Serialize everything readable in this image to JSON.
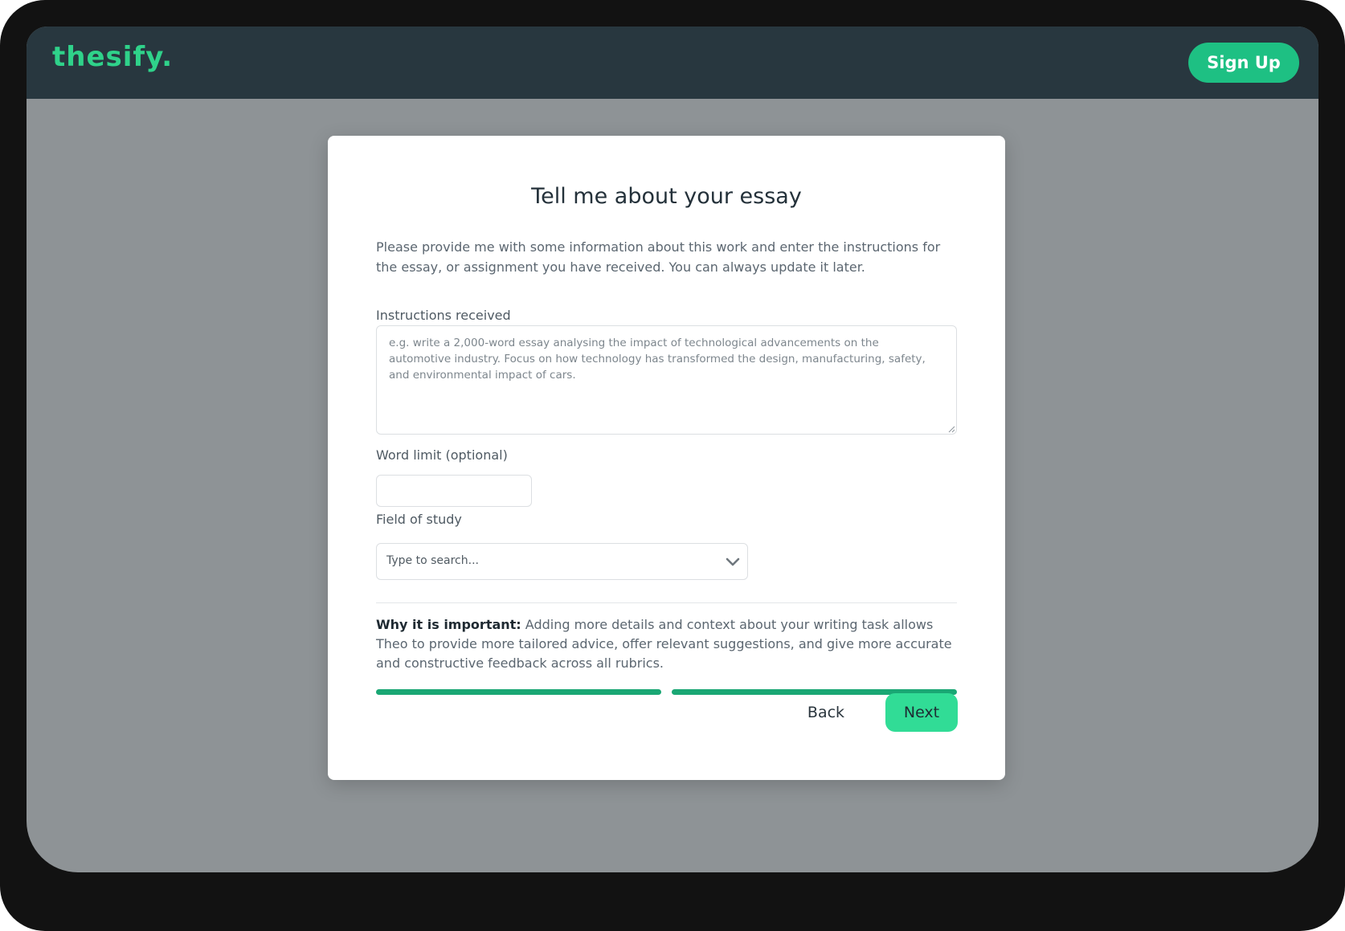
{
  "header": {
    "logo": "thesify.",
    "signup_label": "Sign Up"
  },
  "form": {
    "title": "Tell me about your essay",
    "intro": "Please provide me with some information about this work and enter the instructions for the essay, or assignment you have received. You can always update it later.",
    "instructions": {
      "label": "Instructions received",
      "placeholder": "e.g. write a 2,000-word essay analysing the impact of technological advancements on the automotive industry. Focus on how technology has transformed the design, manufacturing, safety, and environmental impact of cars.",
      "value": ""
    },
    "word_limit": {
      "label": "Word limit (optional)",
      "value": ""
    },
    "field_of_study": {
      "label": "Field of study",
      "placeholder": "Type to search..."
    },
    "why": {
      "lead": "Why it is important:",
      "text": " Adding more details and context about your writing task allows Theo to provide more tailored advice, offer relevant suggestions, and give more accurate and constructive feedback across all rubrics."
    },
    "progress": {
      "total_steps": 2,
      "completed_steps": 2
    },
    "back_label": "Back",
    "next_label": "Next"
  },
  "colors": {
    "brand_green": "#2fd28a",
    "button_green": "#1ec083",
    "next_green": "#31dc96",
    "progress_green": "#1aa774",
    "topbar": "#28373f",
    "overlay": "#8e9396"
  },
  "icons": {
    "field_select": "chevron-down-icon",
    "textarea_resize": "resize-grip-icon"
  }
}
